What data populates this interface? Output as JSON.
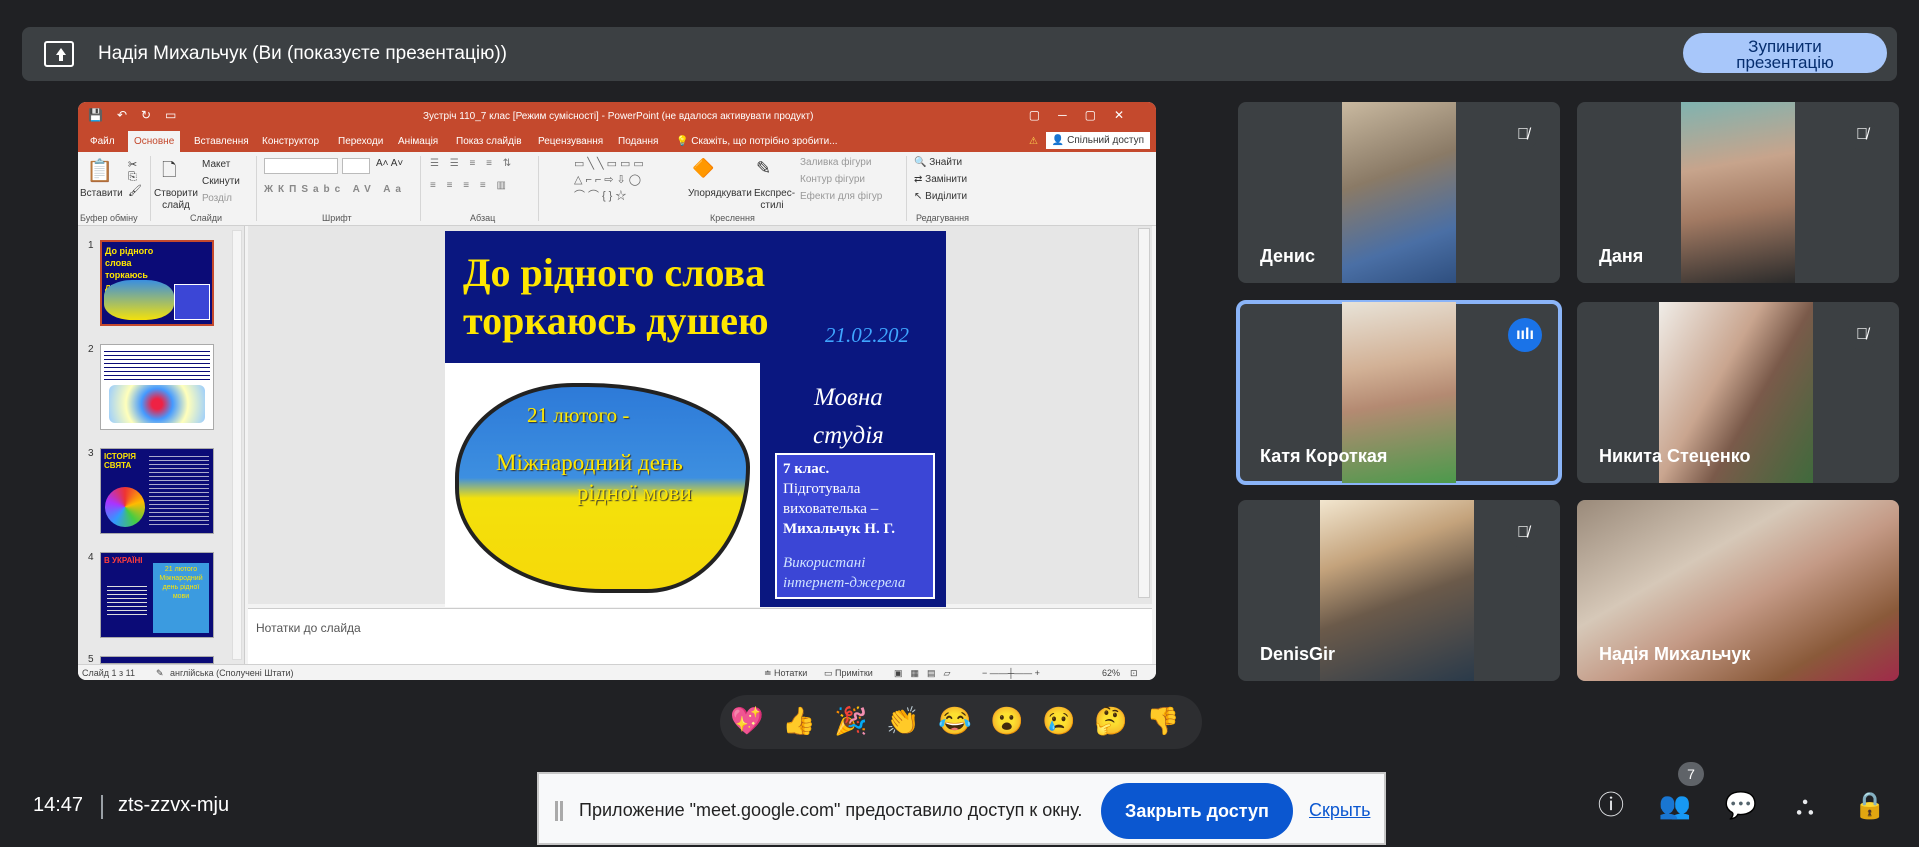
{
  "banner": {
    "title": "Надія Михальчук (Ви (показуєте презентацію))",
    "stop_line1": "Зупинити",
    "stop_line2": "презентацію"
  },
  "ppt": {
    "window_title": "Зустріч 110_7 клас [Режим сумісності] - PowerPoint (не вдалося активувати продукт)",
    "menu": [
      "Файл",
      "Основне",
      "Вставлення",
      "Конструктор",
      "Переходи",
      "Анімація",
      "Показ слайдів",
      "Рецензування",
      "Подання"
    ],
    "tell_me": "Скажіть, що потрібно зробити...",
    "share": "Спільний доступ",
    "ribbon": {
      "paste": "Вставити",
      "new_slide": "Створити слайд",
      "layout": "Макет",
      "reset": "Скинути",
      "section": "Розділ",
      "arrange": "Упорядкувати",
      "quick_styles": "Експрес-стилі",
      "fill": "Заливка фігури",
      "outline": "Контур фігури",
      "effects": "Ефекти для фігур",
      "find": "Знайти",
      "replace": "Замінити",
      "select": "Виділити",
      "groups": [
        "Буфер обміну",
        "Слайди",
        "Шрифт",
        "Абзац",
        "Креслення",
        "Редагування"
      ]
    },
    "notes_placeholder": "Нотатки до слайда",
    "status": {
      "slide": "Слайд 1 з 11",
      "lang": "англійська (Сполучені Штати)",
      "notes": "Нотатки",
      "comments": "Примітки",
      "zoom": "62%"
    },
    "thumb_numbers": [
      "1",
      "2",
      "3",
      "4",
      "5"
    ],
    "thumb_texts": {
      "t1": "До рідного слова торкаюсь душею",
      "t3": "ІСТОРІЯ СВЯТА",
      "t4": "В УКРАЇНІ",
      "t4b": "21 лютого Міжнародний день рідної мови"
    },
    "slide": {
      "line1": "До рідного слова",
      "line2": "торкаюсь душею",
      "date": "21.02.202",
      "map_date": "21 лютого -",
      "map_l1": "Міжнародний день",
      "map_l2": "рідної мови",
      "studio_l1": "Мовна",
      "studio_l2": "студія",
      "box_class": "7 клас.",
      "box_prep": "Підготувала",
      "box_role": "вихователька –",
      "box_name": "Михальчук Н. Г.",
      "box_src1": "Використані",
      "box_src2": "інтернет-джерела"
    }
  },
  "participants": [
    {
      "name": "Денис",
      "muted": true
    },
    {
      "name": "Даня",
      "muted": true
    },
    {
      "name": "Катя Короткая",
      "muted": false,
      "speaking": true
    },
    {
      "name": "Никита Стеценко",
      "muted": true
    },
    {
      "name": "DenisGir",
      "muted": true
    },
    {
      "name": "Надія Михальчук",
      "muted": false
    }
  ],
  "reactions": [
    "💖",
    "👍",
    "🎉",
    "👏",
    "😂",
    "😮",
    "😢",
    "🤔",
    "👎"
  ],
  "bottom": {
    "time": "14:47",
    "code": "zts-zzvx-mju",
    "people_count": "7"
  },
  "notification": {
    "message": "Приложение \"meet.google.com\" предоставило доступ к окну.",
    "close_button": "Закрыть доступ",
    "hide_link": "Скрыть"
  },
  "colors": {
    "accent": "#a8c7fa",
    "ppt_brand": "#c4492d",
    "speaking": "#1a73e8",
    "slide_bg": "#0a1780"
  }
}
